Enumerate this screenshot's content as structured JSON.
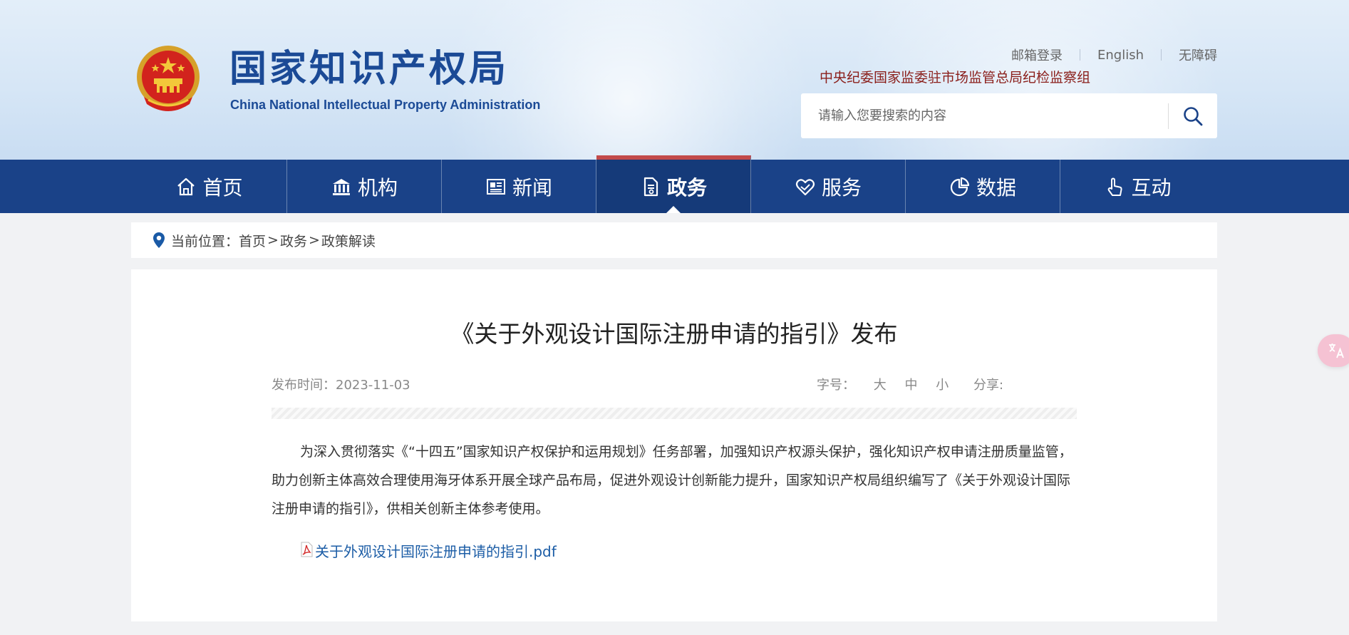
{
  "header": {
    "title_cn": "国家知识产权局",
    "title_en": "China National Intellectual Property Administration",
    "top_links": [
      "邮箱登录",
      "English",
      "无障碍"
    ],
    "discipline": "中央纪委国家监委驻市场监管总局纪检监察组",
    "search": {
      "placeholder": "请输入您要搜索的内容"
    },
    "emblem_icon": "national-emblem-icon"
  },
  "nav": {
    "items": [
      {
        "label": "首页",
        "icon": "home-icon"
      },
      {
        "label": "机构",
        "icon": "institution-icon"
      },
      {
        "label": "新闻",
        "icon": "newspaper-icon"
      },
      {
        "label": "政务",
        "icon": "document-icon",
        "active": true
      },
      {
        "label": "服务",
        "icon": "service-icon"
      },
      {
        "label": "数据",
        "icon": "pie-chart-icon"
      },
      {
        "label": "互动",
        "icon": "hand-pointer-icon"
      }
    ],
    "colors": {
      "bar": "#1a4288",
      "active": "#153a79",
      "active_top": "#c24a4a"
    }
  },
  "breadcrumb": {
    "prefix": "当前位置：",
    "items": [
      "首页",
      "政务",
      "政策解读"
    ],
    "separator": ">"
  },
  "article": {
    "title": "《关于外观设计国际注册申请的指引》发布",
    "date_label": "发布时间：",
    "date": "2023-11-03",
    "font_size_label": "字号：",
    "font_sizes": [
      "大",
      "中",
      "小"
    ],
    "share_label": "分享:",
    "body": "为深入贯彻落实《“十四五”国家知识产权保护和运用规划》任务部署，加强知识产权源头保护，强化知识产权申请注册质量监管，助力创新主体高效合理使用海牙体系开展全球产品布局，促进外观设计创新能力提升，国家知识产权局组织编写了《关于外观设计国际注册申请的指引》，供相关创新主体参考使用。",
    "attachment": "关于外观设计国际注册申请的指引.pdf"
  },
  "floating": {
    "translate_icon": "translate-icon",
    "color": "#f5c2d3"
  }
}
